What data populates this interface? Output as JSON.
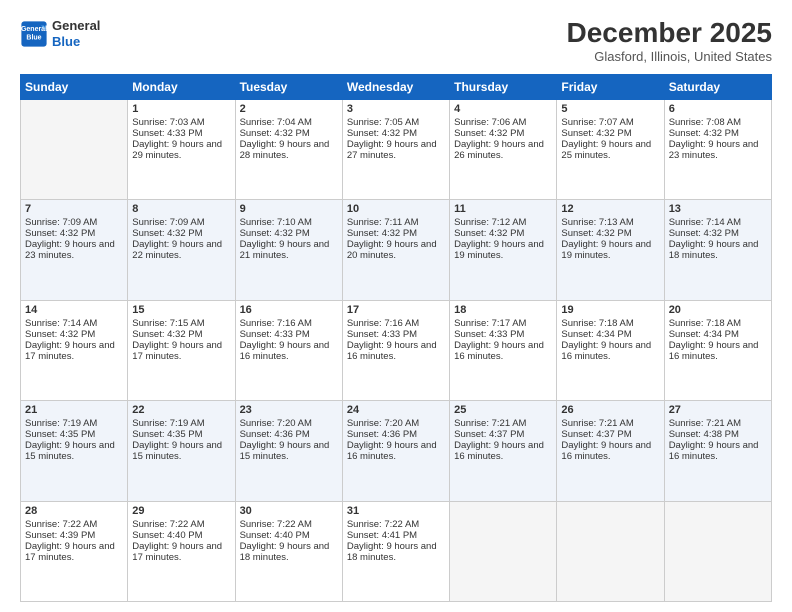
{
  "header": {
    "logo_line1": "General",
    "logo_line2": "Blue",
    "title": "December 2025",
    "subtitle": "Glasford, Illinois, United States"
  },
  "days_of_week": [
    "Sunday",
    "Monday",
    "Tuesday",
    "Wednesday",
    "Thursday",
    "Friday",
    "Saturday"
  ],
  "weeks": [
    [
      {
        "day": "",
        "sunrise": "",
        "sunset": "",
        "daylight": "",
        "empty": true
      },
      {
        "day": "1",
        "sunrise": "Sunrise: 7:03 AM",
        "sunset": "Sunset: 4:33 PM",
        "daylight": "Daylight: 9 hours and 29 minutes."
      },
      {
        "day": "2",
        "sunrise": "Sunrise: 7:04 AM",
        "sunset": "Sunset: 4:32 PM",
        "daylight": "Daylight: 9 hours and 28 minutes."
      },
      {
        "day": "3",
        "sunrise": "Sunrise: 7:05 AM",
        "sunset": "Sunset: 4:32 PM",
        "daylight": "Daylight: 9 hours and 27 minutes."
      },
      {
        "day": "4",
        "sunrise": "Sunrise: 7:06 AM",
        "sunset": "Sunset: 4:32 PM",
        "daylight": "Daylight: 9 hours and 26 minutes."
      },
      {
        "day": "5",
        "sunrise": "Sunrise: 7:07 AM",
        "sunset": "Sunset: 4:32 PM",
        "daylight": "Daylight: 9 hours and 25 minutes."
      },
      {
        "day": "6",
        "sunrise": "Sunrise: 7:08 AM",
        "sunset": "Sunset: 4:32 PM",
        "daylight": "Daylight: 9 hours and 23 minutes."
      }
    ],
    [
      {
        "day": "7",
        "sunrise": "Sunrise: 7:09 AM",
        "sunset": "Sunset: 4:32 PM",
        "daylight": "Daylight: 9 hours and 23 minutes."
      },
      {
        "day": "8",
        "sunrise": "Sunrise: 7:09 AM",
        "sunset": "Sunset: 4:32 PM",
        "daylight": "Daylight: 9 hours and 22 minutes."
      },
      {
        "day": "9",
        "sunrise": "Sunrise: 7:10 AM",
        "sunset": "Sunset: 4:32 PM",
        "daylight": "Daylight: 9 hours and 21 minutes."
      },
      {
        "day": "10",
        "sunrise": "Sunrise: 7:11 AM",
        "sunset": "Sunset: 4:32 PM",
        "daylight": "Daylight: 9 hours and 20 minutes."
      },
      {
        "day": "11",
        "sunrise": "Sunrise: 7:12 AM",
        "sunset": "Sunset: 4:32 PM",
        "daylight": "Daylight: 9 hours and 19 minutes."
      },
      {
        "day": "12",
        "sunrise": "Sunrise: 7:13 AM",
        "sunset": "Sunset: 4:32 PM",
        "daylight": "Daylight: 9 hours and 19 minutes."
      },
      {
        "day": "13",
        "sunrise": "Sunrise: 7:14 AM",
        "sunset": "Sunset: 4:32 PM",
        "daylight": "Daylight: 9 hours and 18 minutes."
      }
    ],
    [
      {
        "day": "14",
        "sunrise": "Sunrise: 7:14 AM",
        "sunset": "Sunset: 4:32 PM",
        "daylight": "Daylight: 9 hours and 17 minutes."
      },
      {
        "day": "15",
        "sunrise": "Sunrise: 7:15 AM",
        "sunset": "Sunset: 4:32 PM",
        "daylight": "Daylight: 9 hours and 17 minutes."
      },
      {
        "day": "16",
        "sunrise": "Sunrise: 7:16 AM",
        "sunset": "Sunset: 4:33 PM",
        "daylight": "Daylight: 9 hours and 16 minutes."
      },
      {
        "day": "17",
        "sunrise": "Sunrise: 7:16 AM",
        "sunset": "Sunset: 4:33 PM",
        "daylight": "Daylight: 9 hours and 16 minutes."
      },
      {
        "day": "18",
        "sunrise": "Sunrise: 7:17 AM",
        "sunset": "Sunset: 4:33 PM",
        "daylight": "Daylight: 9 hours and 16 minutes."
      },
      {
        "day": "19",
        "sunrise": "Sunrise: 7:18 AM",
        "sunset": "Sunset: 4:34 PM",
        "daylight": "Daylight: 9 hours and 16 minutes."
      },
      {
        "day": "20",
        "sunrise": "Sunrise: 7:18 AM",
        "sunset": "Sunset: 4:34 PM",
        "daylight": "Daylight: 9 hours and 16 minutes."
      }
    ],
    [
      {
        "day": "21",
        "sunrise": "Sunrise: 7:19 AM",
        "sunset": "Sunset: 4:35 PM",
        "daylight": "Daylight: 9 hours and 15 minutes."
      },
      {
        "day": "22",
        "sunrise": "Sunrise: 7:19 AM",
        "sunset": "Sunset: 4:35 PM",
        "daylight": "Daylight: 9 hours and 15 minutes."
      },
      {
        "day": "23",
        "sunrise": "Sunrise: 7:20 AM",
        "sunset": "Sunset: 4:36 PM",
        "daylight": "Daylight: 9 hours and 15 minutes."
      },
      {
        "day": "24",
        "sunrise": "Sunrise: 7:20 AM",
        "sunset": "Sunset: 4:36 PM",
        "daylight": "Daylight: 9 hours and 16 minutes."
      },
      {
        "day": "25",
        "sunrise": "Sunrise: 7:21 AM",
        "sunset": "Sunset: 4:37 PM",
        "daylight": "Daylight: 9 hours and 16 minutes."
      },
      {
        "day": "26",
        "sunrise": "Sunrise: 7:21 AM",
        "sunset": "Sunset: 4:37 PM",
        "daylight": "Daylight: 9 hours and 16 minutes."
      },
      {
        "day": "27",
        "sunrise": "Sunrise: 7:21 AM",
        "sunset": "Sunset: 4:38 PM",
        "daylight": "Daylight: 9 hours and 16 minutes."
      }
    ],
    [
      {
        "day": "28",
        "sunrise": "Sunrise: 7:22 AM",
        "sunset": "Sunset: 4:39 PM",
        "daylight": "Daylight: 9 hours and 17 minutes."
      },
      {
        "day": "29",
        "sunrise": "Sunrise: 7:22 AM",
        "sunset": "Sunset: 4:40 PM",
        "daylight": "Daylight: 9 hours and 17 minutes."
      },
      {
        "day": "30",
        "sunrise": "Sunrise: 7:22 AM",
        "sunset": "Sunset: 4:40 PM",
        "daylight": "Daylight: 9 hours and 18 minutes."
      },
      {
        "day": "31",
        "sunrise": "Sunrise: 7:22 AM",
        "sunset": "Sunset: 4:41 PM",
        "daylight": "Daylight: 9 hours and 18 minutes."
      },
      {
        "day": "",
        "sunrise": "",
        "sunset": "",
        "daylight": "",
        "empty": true
      },
      {
        "day": "",
        "sunrise": "",
        "sunset": "",
        "daylight": "",
        "empty": true
      },
      {
        "day": "",
        "sunrise": "",
        "sunset": "",
        "daylight": "",
        "empty": true
      }
    ]
  ]
}
